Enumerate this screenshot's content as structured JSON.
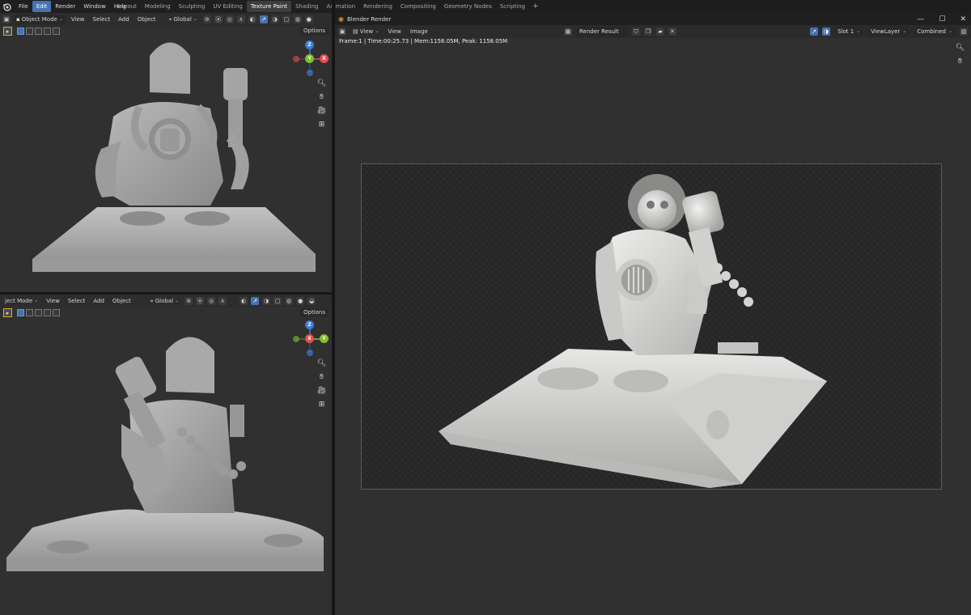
{
  "menu": {
    "items": [
      "File",
      "Edit",
      "Render",
      "Window",
      "Help"
    ],
    "active_index": 1
  },
  "workspaces": {
    "tabs": [
      "Layout",
      "Modeling",
      "Sculpting",
      "UV Editing",
      "Texture Paint",
      "Shading",
      "Animation",
      "Rendering",
      "Compositing",
      "Geometry Nodes",
      "Scripting"
    ],
    "active_index": 4,
    "add_label": "+"
  },
  "viewport_top": {
    "mode": "Object Mode",
    "menus": [
      "View",
      "Select",
      "Add",
      "Object"
    ],
    "orientation": "Global",
    "options": "Options",
    "gizmo": {
      "top": "Z",
      "left": "Y",
      "right": "X"
    }
  },
  "viewport_bottom": {
    "mode": "ject Mode",
    "menus": [
      "View",
      "Select",
      "Add",
      "Object"
    ],
    "orientation": "Global",
    "options": "Options",
    "gizmo": {
      "top": "Z",
      "left": "X",
      "right": "Y"
    }
  },
  "render_window": {
    "title": "Blender Render",
    "header_menus": [
      "View",
      "View",
      "Image"
    ],
    "image_name": "Render Result",
    "slot": "Slot 1",
    "view_layer": "ViewLayer",
    "pass": "Combined",
    "info": "Frame:1 | Time:00:25.73 | Mem:1158.05M, Peak: 1158.05M"
  },
  "colors": {
    "accent": "#4772b3",
    "axis_x": "#e14c4c",
    "axis_y": "#7fbf2e",
    "axis_z": "#3e7bd8",
    "model_gray": "#a8a8a8",
    "render_white": "#d6d6d4"
  }
}
